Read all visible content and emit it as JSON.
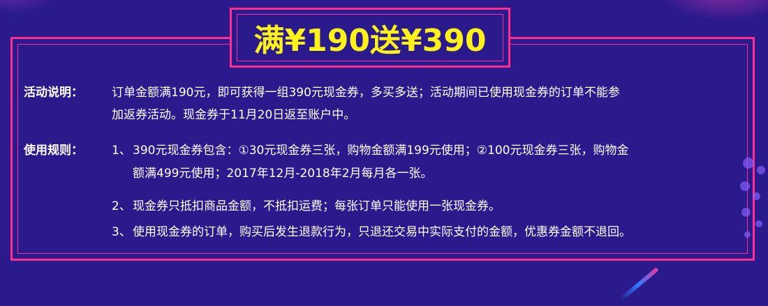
{
  "title": "满¥190送¥390",
  "activity": {
    "label": "活动说明：",
    "line1": "订单金额满190元，即可获得一组390元现金券，多买多送；活动期间已使用现金券的订单不能参",
    "line2": "加返券活动。现金券于11月20日返至账户中。"
  },
  "rules": {
    "label": "使用规则：",
    "items": [
      {
        "number": "1、",
        "line1": "390元现金券包含：①30元现金券三张，购物金额满199元使用；②100元现金券三张，购物金",
        "line2": "额满499元使用；2017年12月-2018年2月每月各一张。"
      },
      {
        "number": "2、",
        "line1": "现金券只抵扣商品金额，不抵扣运费；每张订单只能使用一张现金券。"
      },
      {
        "number": "3、",
        "line1": "使用现金券的订单，购买后发生退款行为，只退还交易中实际支付的金额，优惠券金额不退回。"
      }
    ]
  },
  "colors": {
    "background": "#2b1a8c",
    "frame": "#ff2d8f",
    "title": "#fff21a",
    "text": "#ffffff"
  }
}
